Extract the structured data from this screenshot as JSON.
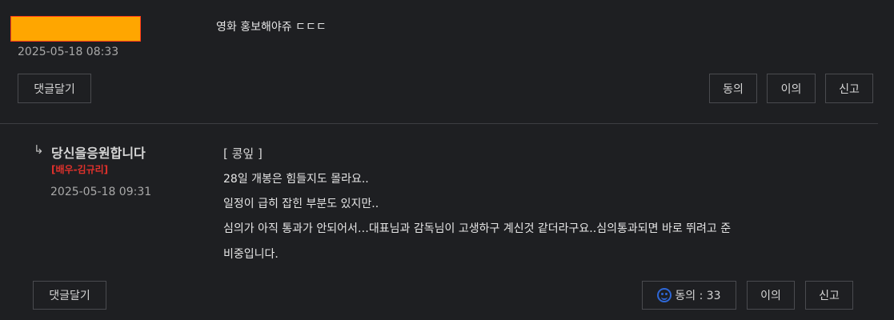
{
  "comment": {
    "date": "2025-05-18 08:33",
    "text": "영화 홍보해야쥬 ㄷㄷㄷ",
    "reply_button": "댓글달기",
    "agree_button": "동의",
    "disagree_button": "이의",
    "report_button": "신고",
    "name_block_color": "#ffa600"
  },
  "reply": {
    "arrow": "↳",
    "author": "당신을응원합니다",
    "tag": "[배우-김규리]",
    "date": "2025-05-18 09:31",
    "header": "[ 콩잎 ]",
    "lines": [
      "28일 개봉은 힘들지도 몰라요..",
      "일정이 급히 잡힌 부분도 있지만..",
      "심의가 아직 통과가 안되어서…대표님과 감독님이 고생하구 계신것 같더라구요..심의통과되면 바로 뛰려고 준",
      "비중입니다."
    ],
    "reply_button": "댓글달기",
    "agree_label": "동의 : 33",
    "disagree_button": "이의",
    "report_button": "신고",
    "tag_color": "#e0312c",
    "smile_icon_color": "#2e67d6"
  }
}
